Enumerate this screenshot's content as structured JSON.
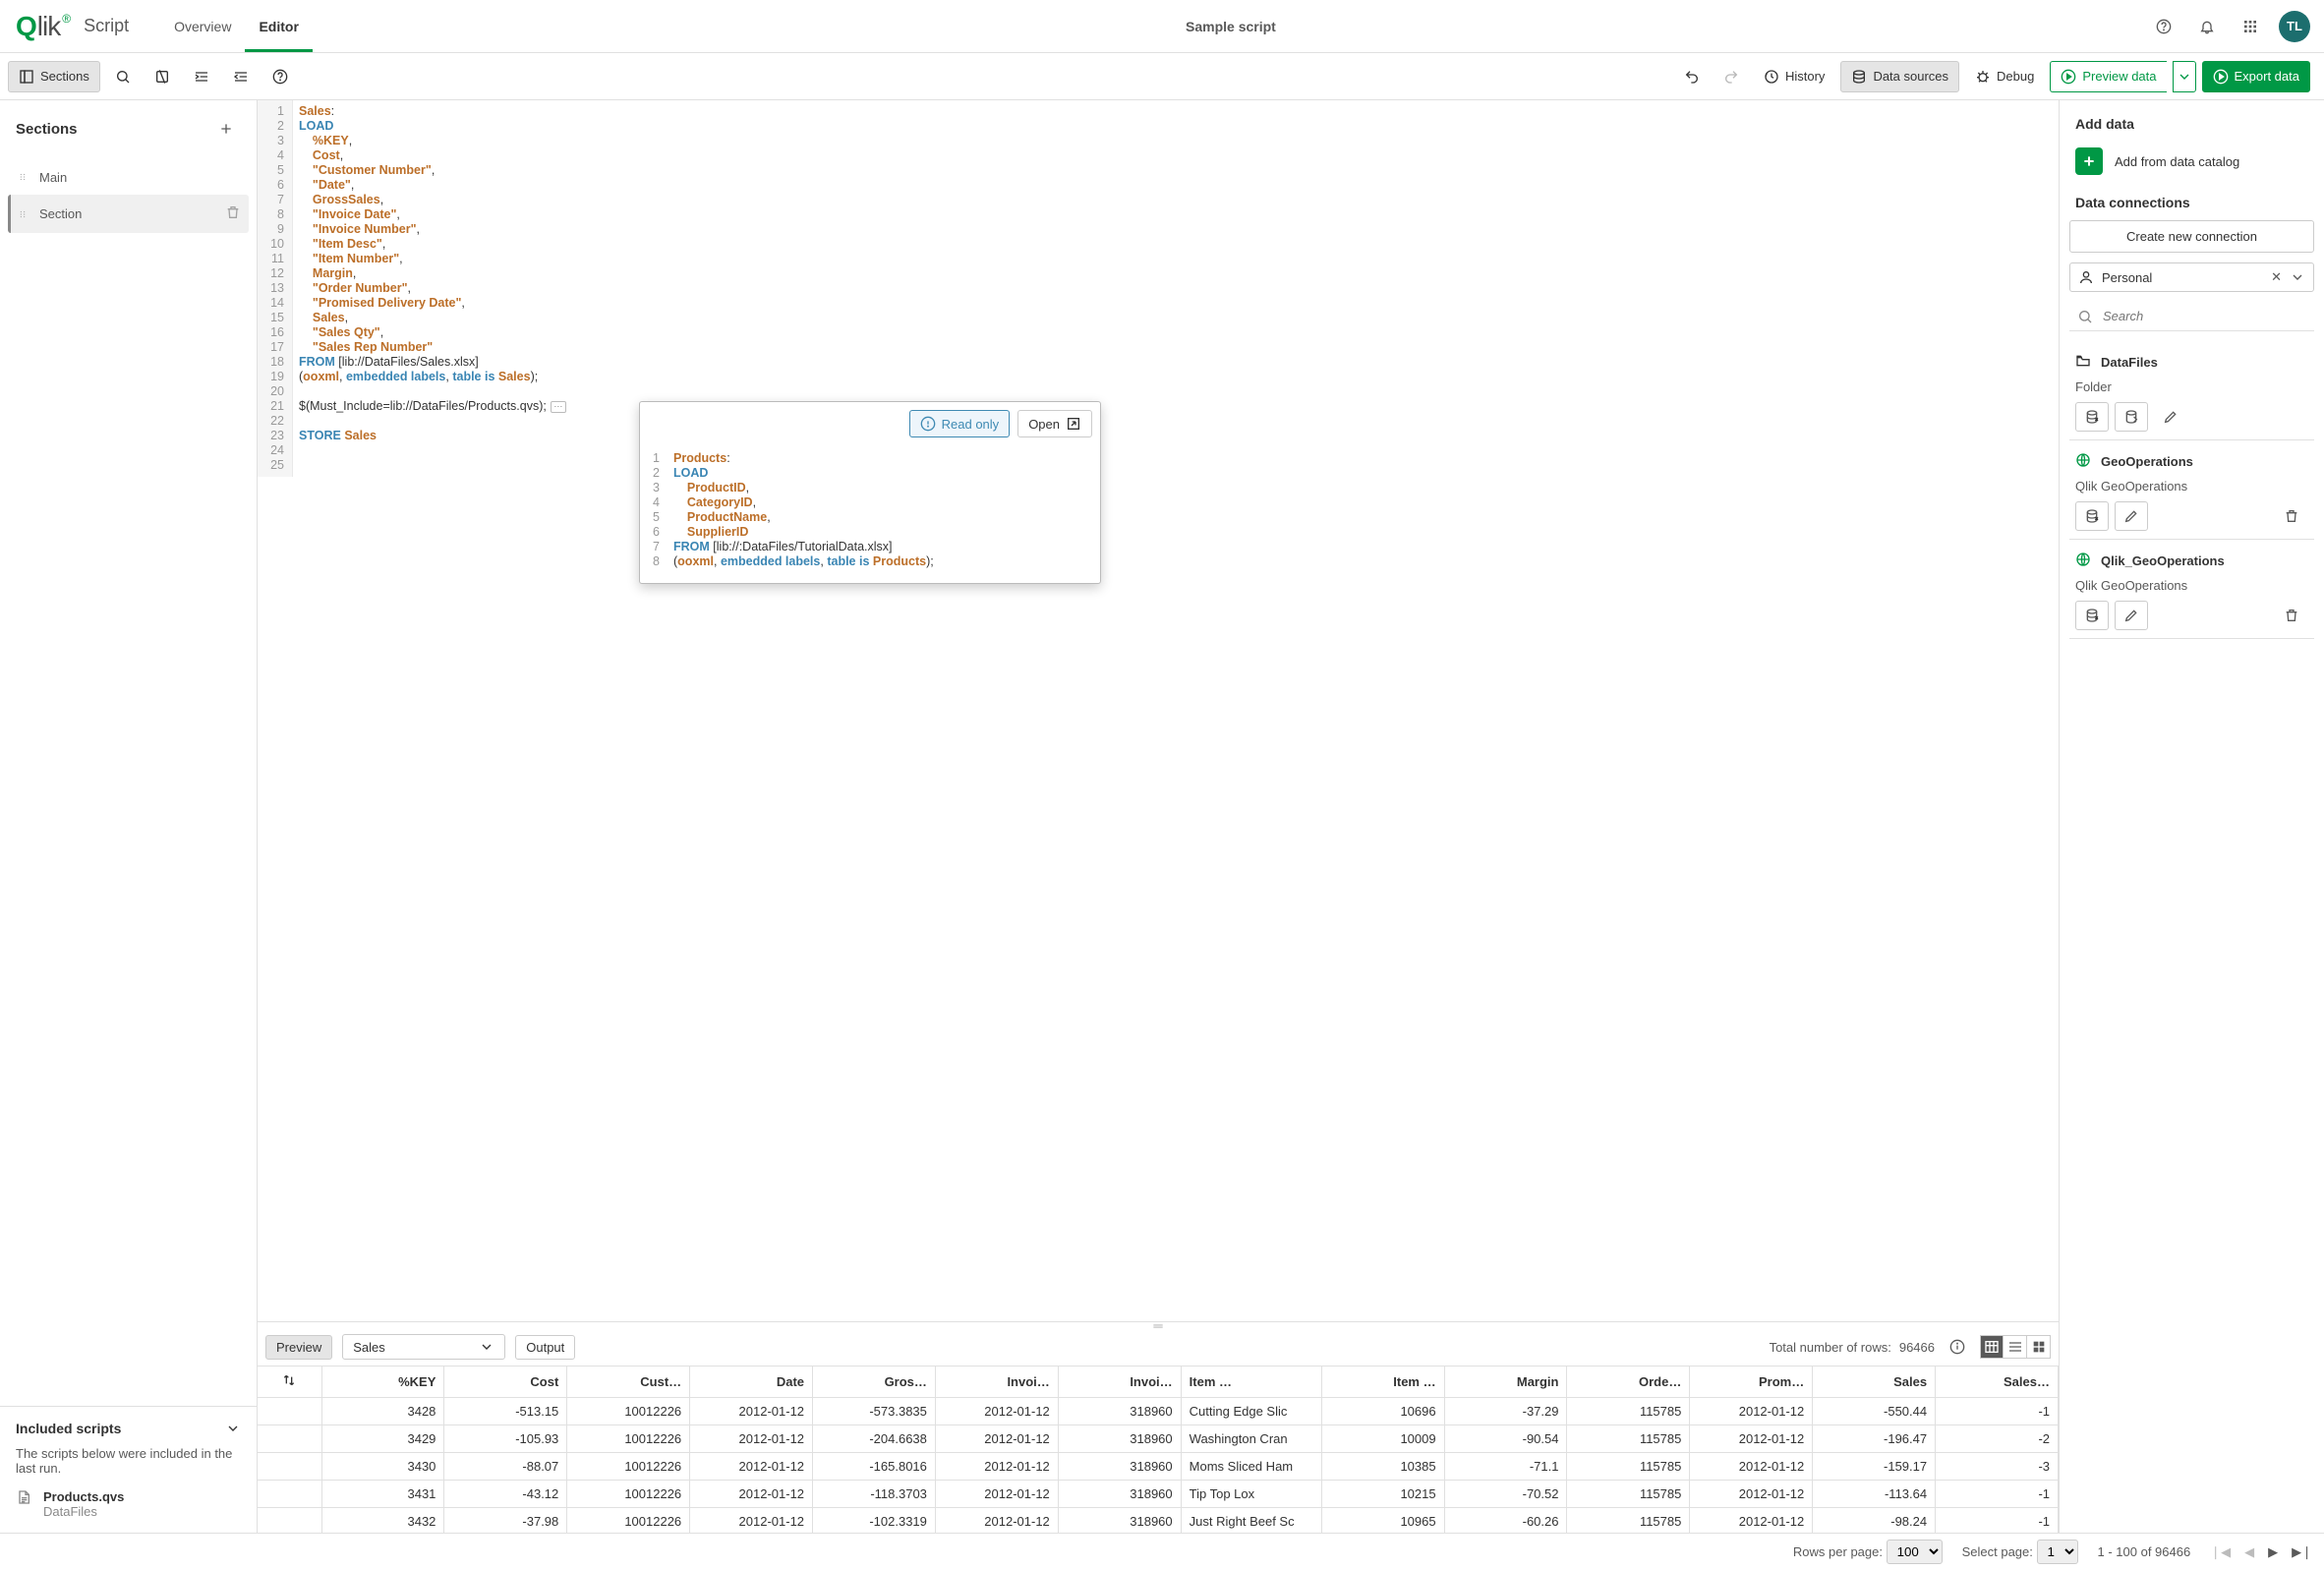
{
  "app": {
    "logo_text": "Qlik",
    "title": "Script",
    "tabs": [
      "Overview",
      "Editor"
    ],
    "active_tab": "Editor",
    "doc_title": "Sample script",
    "avatar": "TL"
  },
  "toolbar": {
    "sections_btn": "Sections",
    "history": "History",
    "data_sources": "Data sources",
    "debug": "Debug",
    "preview_data": "Preview data",
    "export_data": "Export data"
  },
  "sections": {
    "title": "Sections",
    "items": [
      {
        "label": "Main",
        "active": false
      },
      {
        "label": "Section",
        "active": true
      }
    ]
  },
  "included": {
    "title": "Included scripts",
    "desc": "The scripts below were included in the last run.",
    "entries": [
      {
        "name": "Products.qvs",
        "location": "DataFiles"
      }
    ]
  },
  "code_main": {
    "lines": [
      [
        [
          "id",
          "Sales"
        ],
        [
          "op",
          ":"
        ]
      ],
      [
        [
          "kw",
          "LOAD"
        ]
      ],
      [
        [
          "op",
          "    "
        ],
        [
          "id",
          "%KEY"
        ],
        [
          "op",
          ","
        ]
      ],
      [
        [
          "op",
          "    "
        ],
        [
          "id",
          "Cost"
        ],
        [
          "op",
          ","
        ]
      ],
      [
        [
          "op",
          "    "
        ],
        [
          "str",
          "\"Customer Number\""
        ],
        [
          "op",
          ","
        ]
      ],
      [
        [
          "op",
          "    "
        ],
        [
          "str",
          "\"Date\""
        ],
        [
          "op",
          ","
        ]
      ],
      [
        [
          "op",
          "    "
        ],
        [
          "id",
          "GrossSales"
        ],
        [
          "op",
          ","
        ]
      ],
      [
        [
          "op",
          "    "
        ],
        [
          "str",
          "\"Invoice Date\""
        ],
        [
          "op",
          ","
        ]
      ],
      [
        [
          "op",
          "    "
        ],
        [
          "str",
          "\"Invoice Number\""
        ],
        [
          "op",
          ","
        ]
      ],
      [
        [
          "op",
          "    "
        ],
        [
          "str",
          "\"Item Desc\""
        ],
        [
          "op",
          ","
        ]
      ],
      [
        [
          "op",
          "    "
        ],
        [
          "str",
          "\"Item Number\""
        ],
        [
          "op",
          ","
        ]
      ],
      [
        [
          "op",
          "    "
        ],
        [
          "id",
          "Margin"
        ],
        [
          "op",
          ","
        ]
      ],
      [
        [
          "op",
          "    "
        ],
        [
          "str",
          "\"Order Number\""
        ],
        [
          "op",
          ","
        ]
      ],
      [
        [
          "op",
          "    "
        ],
        [
          "str",
          "\"Promised Delivery Date\""
        ],
        [
          "op",
          ","
        ]
      ],
      [
        [
          "op",
          "    "
        ],
        [
          "id",
          "Sales"
        ],
        [
          "op",
          ","
        ]
      ],
      [
        [
          "op",
          "    "
        ],
        [
          "str",
          "\"Sales Qty\""
        ],
        [
          "op",
          ","
        ]
      ],
      [
        [
          "op",
          "    "
        ],
        [
          "str",
          "\"Sales Rep Number\""
        ]
      ],
      [
        [
          "kw",
          "FROM"
        ],
        [
          "op",
          " "
        ],
        [
          "path",
          "[lib://DataFiles/Sales.xlsx]"
        ]
      ],
      [
        [
          "op",
          "("
        ],
        [
          "id",
          "ooxml"
        ],
        [
          "op",
          ", "
        ],
        [
          "kw",
          "embedded labels"
        ],
        [
          "op",
          ", "
        ],
        [
          "kw",
          "table is"
        ],
        [
          "op",
          " "
        ],
        [
          "id",
          "Sales"
        ],
        [
          "op",
          ");"
        ]
      ],
      [
        [
          "op",
          ""
        ]
      ],
      [
        [
          "op",
          "$(Must_Include=lib://DataFiles/Products.qvs);"
        ]
      ],
      [
        [
          "op",
          ""
        ]
      ],
      [
        [
          "kw",
          "STORE"
        ],
        [
          "op",
          " "
        ],
        [
          "id",
          "Sales"
        ]
      ],
      [
        [
          "op",
          ""
        ]
      ],
      [
        [
          "op",
          ""
        ]
      ]
    ]
  },
  "snippet": {
    "read_only": "Read only",
    "open": "Open",
    "lines": [
      [
        [
          "id",
          "Products"
        ],
        [
          "op",
          ":"
        ]
      ],
      [
        [
          "kw",
          "LOAD"
        ]
      ],
      [
        [
          "op",
          "    "
        ],
        [
          "id",
          "ProductID"
        ],
        [
          "op",
          ","
        ]
      ],
      [
        [
          "op",
          "    "
        ],
        [
          "id",
          "CategoryID"
        ],
        [
          "op",
          ","
        ]
      ],
      [
        [
          "op",
          "    "
        ],
        [
          "id",
          "ProductName"
        ],
        [
          "op",
          ","
        ]
      ],
      [
        [
          "op",
          "    "
        ],
        [
          "id",
          "SupplierID"
        ]
      ],
      [
        [
          "kw",
          "FROM"
        ],
        [
          "op",
          " "
        ],
        [
          "path",
          "[lib://:DataFiles/TutorialData.xlsx]"
        ]
      ],
      [
        [
          "op",
          "("
        ],
        [
          "id",
          "ooxml"
        ],
        [
          "op",
          ", "
        ],
        [
          "kw",
          "embedded labels"
        ],
        [
          "op",
          ", "
        ],
        [
          "kw",
          "table is"
        ],
        [
          "op",
          " "
        ],
        [
          "id",
          "Products"
        ],
        [
          "op",
          ");"
        ]
      ]
    ]
  },
  "right": {
    "add_data": "Add data",
    "add_catalog": "Add from data catalog",
    "connections_title": "Data connections",
    "create_conn": "Create new connection",
    "space_selected": "Personal",
    "search_placeholder": "Search",
    "entries": [
      {
        "icon": "folder",
        "name": "DataFiles",
        "sub": "Folder",
        "actions": [
          "select",
          "insert",
          "edit-ghost"
        ]
      },
      {
        "icon": "globe",
        "name": "GeoOperations",
        "sub": "Qlik GeoOperations",
        "actions": [
          "select",
          "edit",
          "delete"
        ]
      },
      {
        "icon": "globe",
        "name": "Qlik_GeoOperations",
        "sub": "Qlik GeoOperations",
        "actions": [
          "select",
          "edit",
          "delete"
        ]
      }
    ]
  },
  "preview": {
    "preview_btn": "Preview",
    "table_selected": "Sales",
    "output_btn": "Output",
    "total_rows_label": "Total number of rows:",
    "total_rows_value": "96466",
    "columns": [
      "",
      "%KEY",
      "Cost",
      "Cust…",
      "Date",
      "Gros…",
      "Invoi…",
      "Invoi…",
      "Item …",
      "Item …",
      "Margin",
      "Orde…",
      "Prom…",
      "Sales",
      "Sales…"
    ],
    "rows": [
      [
        "",
        "3428",
        "-513.15",
        "10012226",
        "2012-01-12",
        "-573.3835",
        "2012-01-12",
        "318960",
        "Cutting Edge Slic",
        "10696",
        "-37.29",
        "115785",
        "2012-01-12",
        "-550.44",
        "-1"
      ],
      [
        "",
        "3429",
        "-105.93",
        "10012226",
        "2012-01-12",
        "-204.6638",
        "2012-01-12",
        "318960",
        "Washington Cran",
        "10009",
        "-90.54",
        "115785",
        "2012-01-12",
        "-196.47",
        "-2"
      ],
      [
        "",
        "3430",
        "-88.07",
        "10012226",
        "2012-01-12",
        "-165.8016",
        "2012-01-12",
        "318960",
        "Moms Sliced Ham",
        "10385",
        "-71.1",
        "115785",
        "2012-01-12",
        "-159.17",
        "-3"
      ],
      [
        "",
        "3431",
        "-43.12",
        "10012226",
        "2012-01-12",
        "-118.3703",
        "2012-01-12",
        "318960",
        "Tip Top Lox",
        "10215",
        "-70.52",
        "115785",
        "2012-01-12",
        "-113.64",
        "-1"
      ],
      [
        "",
        "3432",
        "-37.98",
        "10012226",
        "2012-01-12",
        "-102.3319",
        "2012-01-12",
        "318960",
        "Just Right Beef Sc",
        "10965",
        "-60.26",
        "115785",
        "2012-01-12",
        "-98.24",
        "-1"
      ]
    ]
  },
  "pager": {
    "rows_per_page_label": "Rows per page:",
    "rows_per_page_value": "100",
    "select_page_label": "Select page:",
    "select_page_value": "1",
    "range": "1 - 100 of 96466"
  }
}
